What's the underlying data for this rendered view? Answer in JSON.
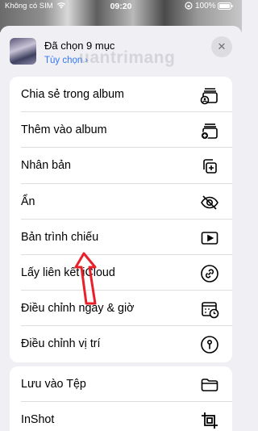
{
  "status_bar": {
    "carrier": "Không có SIM",
    "time": "09:20",
    "battery": "100%"
  },
  "header": {
    "title": "Đã chọn 9 mục",
    "options_label": "Tùy chọn",
    "options_chevron": "›",
    "close_icon_glyph": "✕",
    "watermark": "uantrimang"
  },
  "menu_group_1": [
    {
      "label": "Chia sẻ trong album",
      "icon": "shared-album-icon"
    },
    {
      "label": "Thêm vào album",
      "icon": "add-to-album-icon"
    },
    {
      "label": "Nhân bản",
      "icon": "duplicate-icon"
    },
    {
      "label": "Ẩn",
      "icon": "hide-eye-icon"
    },
    {
      "label": "Bản trình chiếu",
      "icon": "slideshow-play-icon"
    },
    {
      "label": "Lấy liên kết iCloud",
      "icon": "link-icon"
    },
    {
      "label": "Điều chỉnh ngày & giờ",
      "icon": "calendar-clock-icon"
    },
    {
      "label": "Điều chỉnh vị trí",
      "icon": "location-info-icon"
    }
  ],
  "menu_group_2": [
    {
      "label": "Lưu vào Tệp",
      "icon": "folder-icon"
    },
    {
      "label": "InShot",
      "icon": "crop-icon"
    }
  ],
  "colors": {
    "accent": "#3478f6",
    "annotation_arrow": "#e8202a",
    "sheet_background": "#efeff4"
  }
}
